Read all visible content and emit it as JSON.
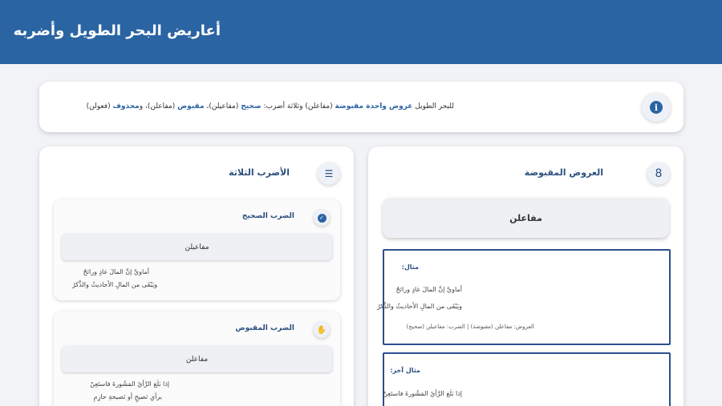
{
  "header": {
    "title": "أعاريض البحر الطويل وأضربه"
  },
  "info": {
    "icon": "info-icon",
    "text_parts": [
      "للبحر الطويل ",
      "عروض واحدة مقبوضة",
      " (مفاعلن) وثلاثة أضرب: ",
      "صحيح",
      " (مفاعيلن)، ",
      "مقبوض",
      " (مفاعلن)، و",
      "محذوف",
      " (فعولن)"
    ]
  },
  "right_panel": {
    "title": "العروض المقبوضة",
    "icon": "number-8-icon",
    "icon_glyph": "8",
    "pattern": "مفاعلن",
    "example1": {
      "label": "مثال:",
      "line1": "أماويَّ إنَّ المالَ غادٍ ورائحٌ",
      "line2": "ويَبْقَى من المالِ الأحاديثُ والذِّكرُ",
      "meta": "العروض: مفاعلن (مقبوضة) | الضرب: مفاعيلن (صحيح)"
    },
    "example2": {
      "label": "مثال آخر:",
      "line1": "إذا بَلَغ الرَّأيُ المَشُورةَ فاستَعِنْ"
    }
  },
  "left_panel": {
    "title": "الأضرب الثلاثة",
    "icon": "list-icon",
    "icon_glyph": "☰",
    "cards": [
      {
        "title": "الضرب الصحيح",
        "icon": "check-circle-icon",
        "pattern": "مفاعيلن",
        "line1": "أماويَّ إنَّ المالَ غادٍ ورائحٌ",
        "line2": "ويَبْقَى من المالِ الأحاديثُ والذِّكرُ"
      },
      {
        "title": "الضرب المقبوض",
        "icon": "hand-icon",
        "pattern": "مفاعلن",
        "line1": "إذا بَلَغ الرَّأيُ المَشُورةَ فاستَعِنْ",
        "line2": "برأيِ نَصيحٍ أو نَصيحةِ حازِمِ"
      }
    ]
  },
  "colors": {
    "header_bg": "#2b64a3",
    "accent": "#2b4f7e"
  }
}
